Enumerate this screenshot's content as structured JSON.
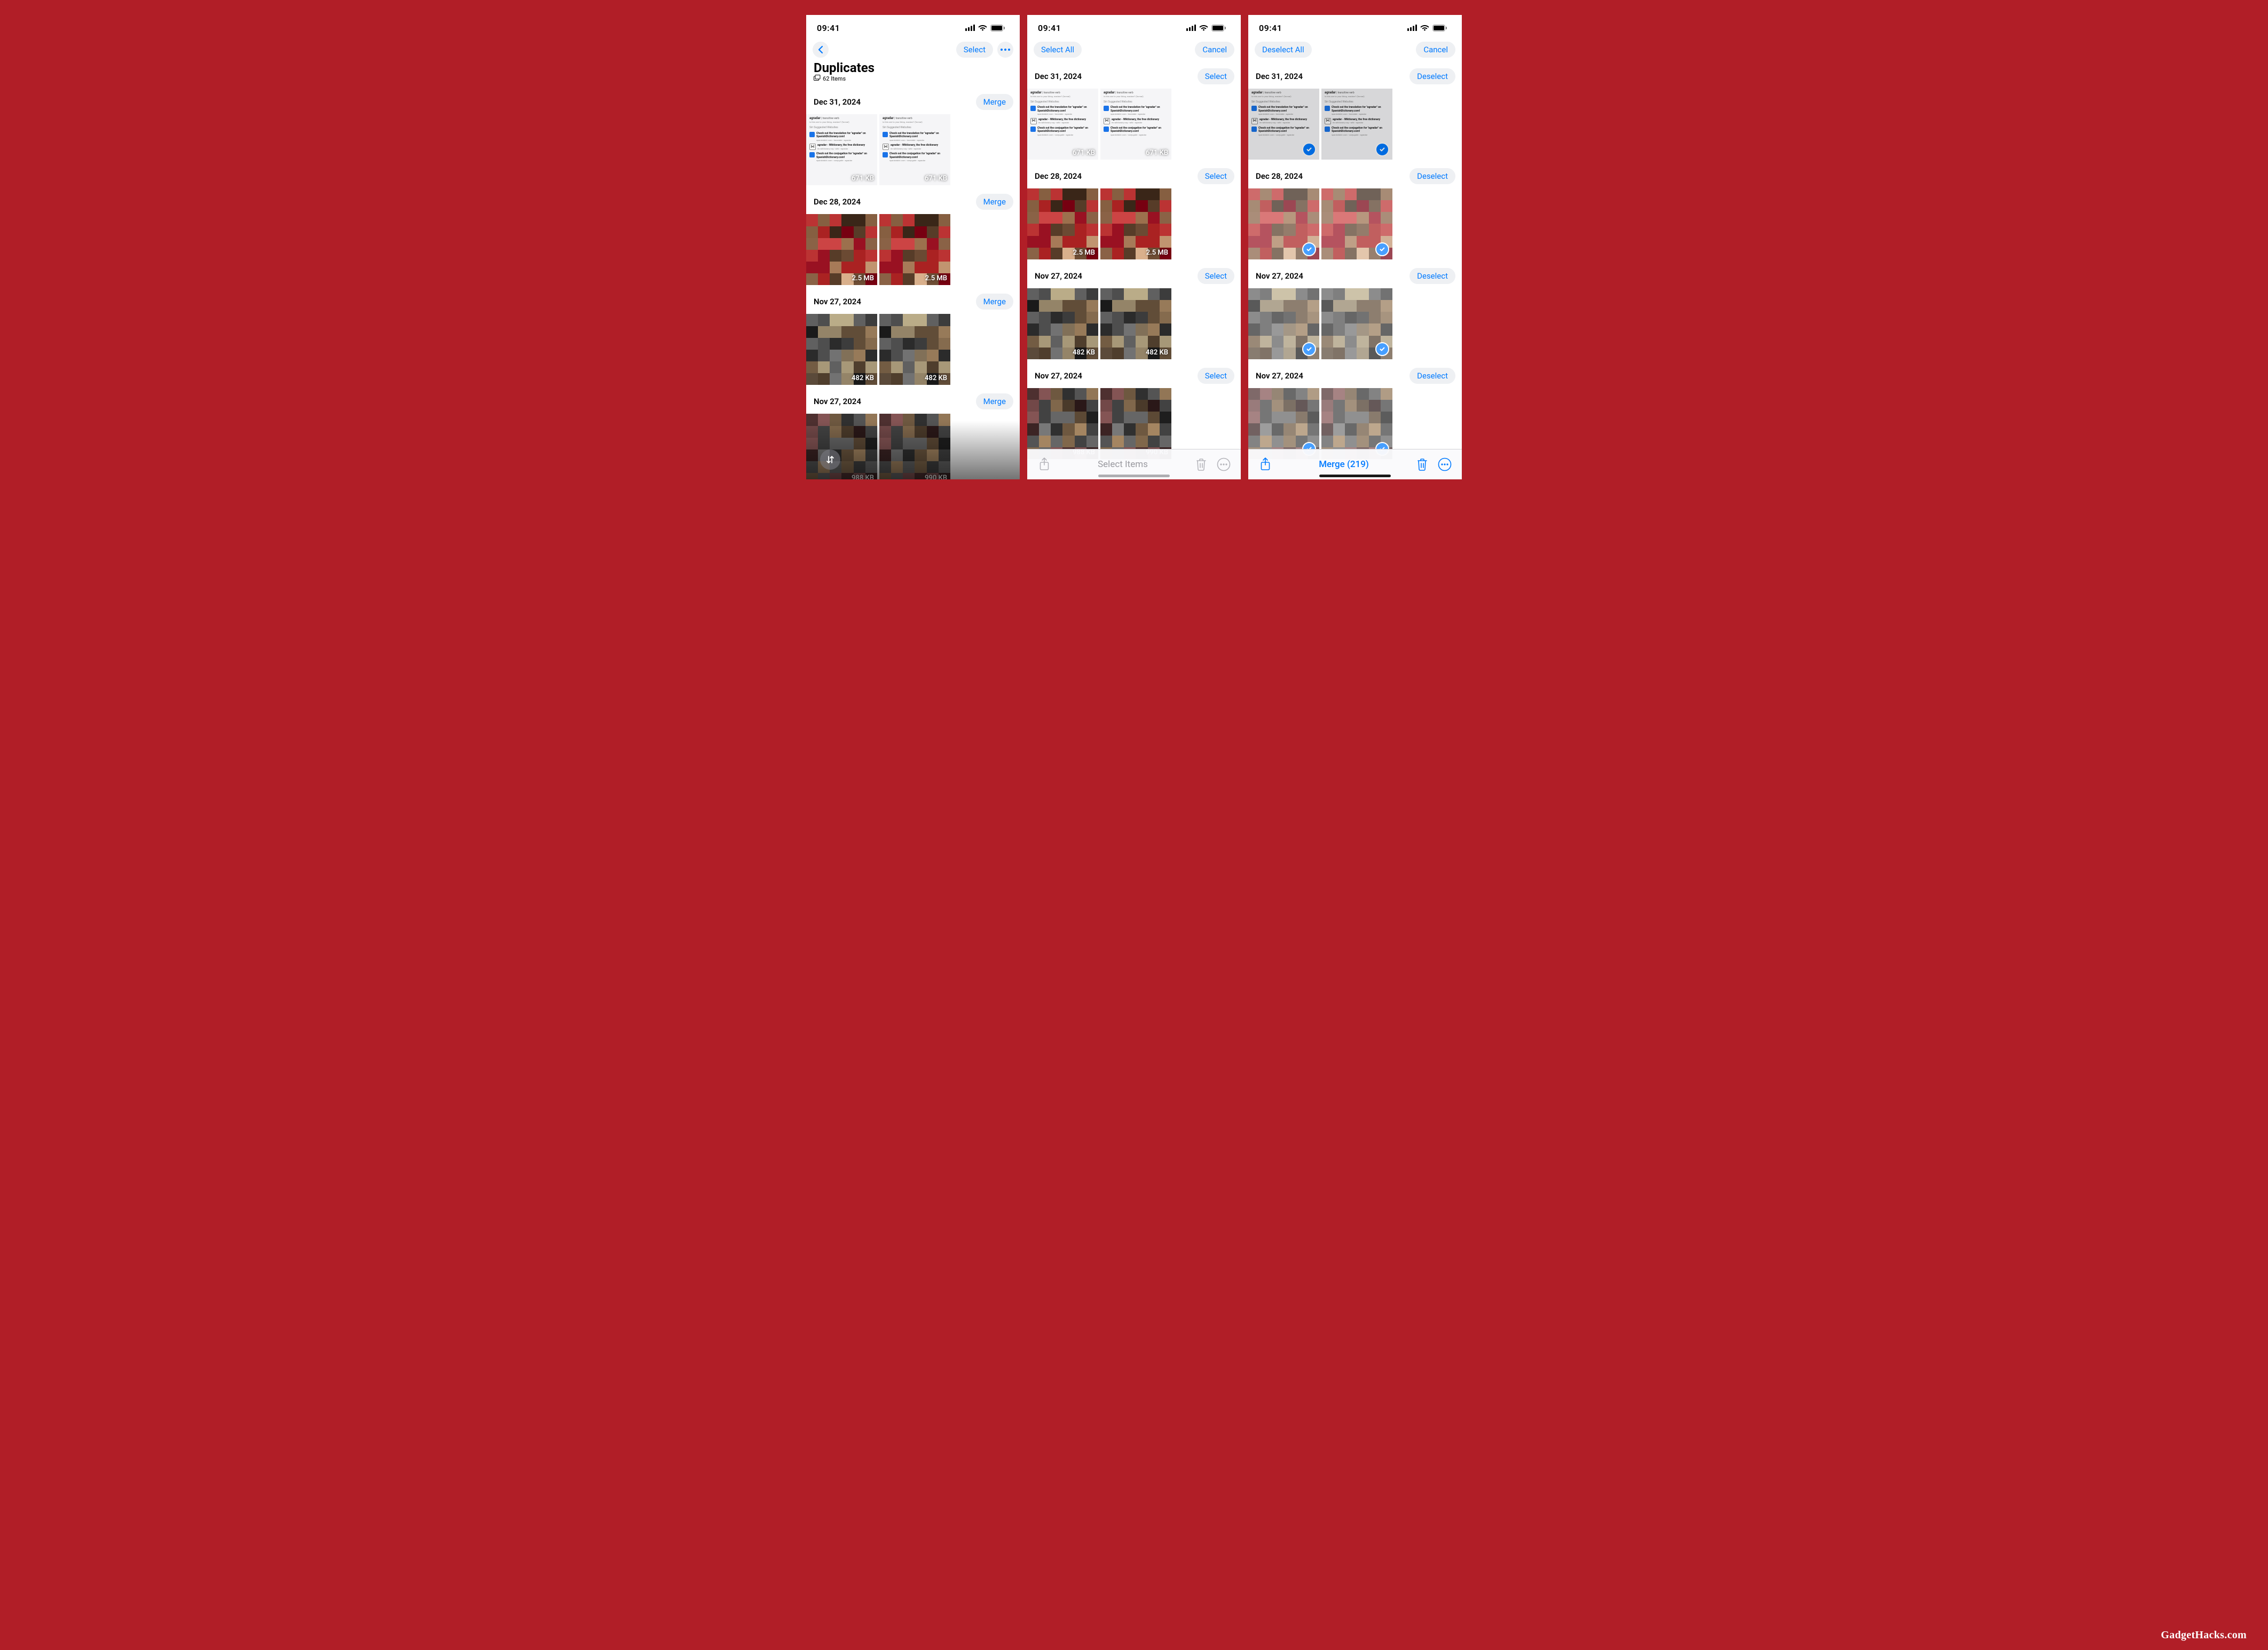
{
  "status": {
    "time": "09:41"
  },
  "watermark": "GadgetHacks.com",
  "screens": [
    {
      "id": "browse",
      "nav": {
        "back": true,
        "left_pill": null,
        "right_pill": "Select",
        "right_more": true
      },
      "header": {
        "title": "Duplicates",
        "subtitle": "62 Items"
      },
      "group_action": "Merge",
      "selection_mode": false,
      "has_bottom_bar": false,
      "has_float_sort": true,
      "has_fade": true
    },
    {
      "id": "select",
      "nav": {
        "back": false,
        "left_pill": "Select All",
        "right_pill": "Cancel",
        "right_more": false
      },
      "header": null,
      "group_action": "Select",
      "selection_mode": false,
      "has_bottom_bar": true,
      "bottom": {
        "center": "Select Items",
        "state": "disabled",
        "home_grey": true
      },
      "has_float_sort": false,
      "has_fade": false
    },
    {
      "id": "selected",
      "nav": {
        "back": false,
        "left_pill": "Deselect All",
        "right_pill": "Cancel",
        "right_more": false
      },
      "header": null,
      "group_action": "Deselect",
      "selection_mode": true,
      "has_bottom_bar": true,
      "bottom": {
        "center": "Merge (219)",
        "state": "active",
        "home_grey": false
      },
      "has_float_sort": false,
      "has_fade": false
    }
  ],
  "groups": [
    {
      "date": "Dec 31, 2024",
      "kind": "screenshot",
      "sizes": [
        "671 KB",
        "671 KB"
      ]
    },
    {
      "date": "Dec 28, 2024",
      "kind": "photo-red",
      "sizes": [
        "2.5 MB",
        "2.5 MB"
      ]
    },
    {
      "date": "Nov 27, 2024",
      "kind": "photo-crowd",
      "sizes": [
        "482 KB",
        "482 KB"
      ]
    },
    {
      "date": "Nov 27, 2024",
      "kind": "photo-crowd2",
      "sizes": [
        "988 KB",
        "990 KB"
      ]
    }
  ],
  "screenshot_content": {
    "heading": "agradar",
    "sub": "transitive verb",
    "note": "Is this one to your liking, madam? (formal)",
    "section": "Siri Suggested Websites",
    "items": [
      {
        "icon": "safari",
        "t1": "Check out the translation for \"agradar\" on SpanishDictionary.com!",
        "t2": "spanishdict.com › translate › agradar"
      },
      {
        "icon": "w",
        "t1": "agradar - Wiktionary, the free dictionary",
        "t2": "en.wiktionary.org › wiki › agradar"
      },
      {
        "icon": "safari",
        "t1": "Check out the conjugation for \"agradar\" on SpanishDictionary.com!",
        "t2": "spanishdict.com › conjugate › agradar"
      }
    ]
  }
}
